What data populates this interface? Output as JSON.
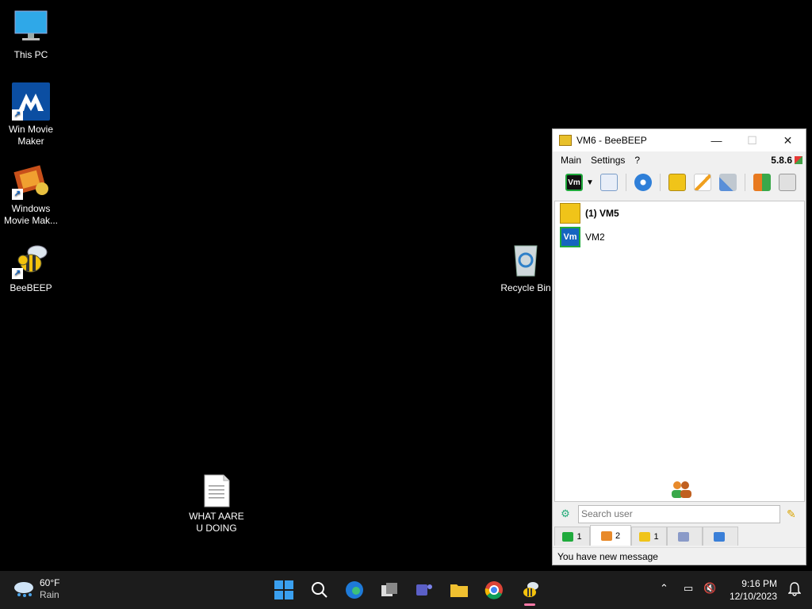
{
  "desktop": {
    "icons": [
      {
        "label": "This PC"
      },
      {
        "label": "Win Movie Maker"
      },
      {
        "label": "Windows Movie Mak..."
      },
      {
        "label": "BeeBEEP"
      },
      {
        "label": "Recycle Bin"
      },
      {
        "label": "WHAT AARE U DOING"
      }
    ]
  },
  "window": {
    "title": "VM6 - BeeBEEP",
    "minimize": "—",
    "maximize": "☐",
    "close": "✕",
    "menu": [
      "Main",
      "Settings",
      "?"
    ],
    "version": "5.8.6",
    "users": [
      {
        "name": "(1) VM5",
        "avatar": "",
        "bold": true
      },
      {
        "name": "VM2",
        "avatar": "Vm",
        "bold": false
      }
    ],
    "toolbar_avatar": "Vm",
    "search_placeholder": "Search user",
    "tabs": [
      {
        "count": "1"
      },
      {
        "count": "2"
      },
      {
        "count": "1"
      },
      {
        "count": ""
      },
      {
        "count": ""
      }
    ],
    "status": "You have new message"
  },
  "taskbar": {
    "weather_temp": "60°F",
    "weather_desc": "Rain",
    "time": "9:16 PM",
    "date": "12/10/2023"
  },
  "colors": {
    "accent_green": "#1faa3c",
    "vm2_blue": "#1565c0",
    "folder_yellow": "#f0c419"
  }
}
